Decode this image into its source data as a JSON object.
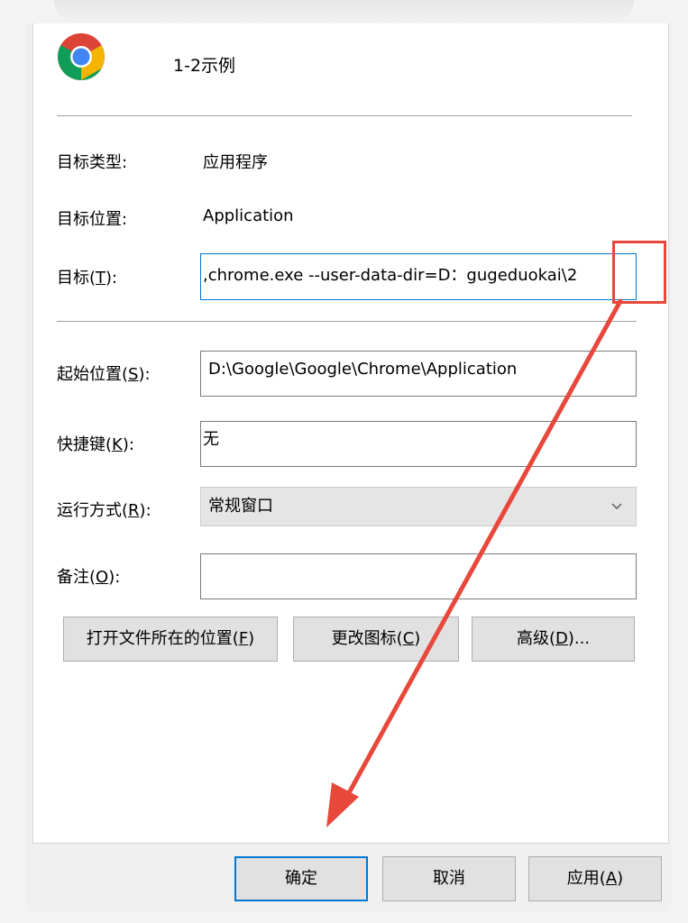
{
  "header": {
    "shortcut_name": "1-2示例",
    "icon": "chrome-icon"
  },
  "fields": {
    "target_type_label": "目标类型:",
    "target_type_value": "应用程序",
    "target_location_label": "目标位置:",
    "target_location_value": "Application",
    "target_label_pre": "目标(",
    "target_label_key": "T",
    "target_label_post": "):",
    "target_value": ",chrome.exe --user-data-dir=D：gugeduokai\\2",
    "start_in_label_pre": "起始位置(",
    "start_in_label_key": "S",
    "start_in_label_post": "):",
    "start_in_value": "D:\\Google\\Google\\Chrome\\Application",
    "shortcut_key_label_pre": "快捷键(",
    "shortcut_key_label_key": "K",
    "shortcut_key_label_post": "):",
    "shortcut_key_value": "无",
    "run_label_pre": "运行方式(",
    "run_label_key": "R",
    "run_label_post": "):",
    "run_value": "常规窗口",
    "comment_label_pre": "备注(",
    "comment_label_key": "O",
    "comment_label_post": "):",
    "comment_value": ""
  },
  "action_buttons": {
    "open_location_pre": "打开文件所在的位置(",
    "open_location_key": "F",
    "open_location_post": ")",
    "change_icon_pre": "更改图标(",
    "change_icon_key": "C",
    "change_icon_post": ")",
    "advanced_pre": "高级(",
    "advanced_key": "D",
    "advanced_post": ")..."
  },
  "footer": {
    "ok": "确定",
    "cancel": "取消",
    "apply_pre": "应用(",
    "apply_key": "A",
    "apply_post": ")"
  },
  "colors": {
    "annotation": "#e8483b",
    "focus": "#0078d7"
  }
}
